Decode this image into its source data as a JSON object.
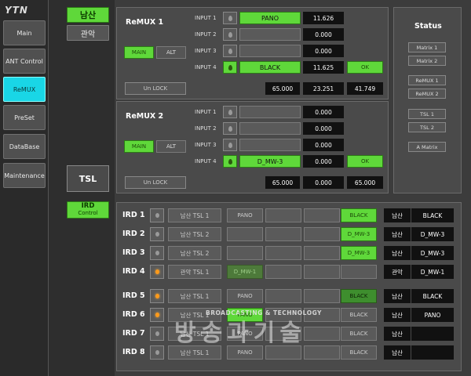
{
  "logo": "YTN",
  "sidebar": [
    {
      "label": "Main",
      "active": false
    },
    {
      "label": "ANT Control",
      "active": false
    },
    {
      "label": "ReMUX",
      "active": true
    },
    {
      "label": "PreSet",
      "active": false
    },
    {
      "label": "DataBase",
      "active": false
    },
    {
      "label": "Maintenance",
      "active": false
    }
  ],
  "site_tabs": {
    "namsan": "남산",
    "gwanak": "관악"
  },
  "tsl_button": "TSL",
  "ird_control": {
    "line1": "IRD",
    "line2": "Control"
  },
  "remux1": {
    "title": "ReMUX 1",
    "main": "MAIN",
    "alt": "ALT",
    "unlock": "Un LOCK",
    "inputs": [
      {
        "label": "INPUT 1",
        "lit": false,
        "source": "PANO",
        "source_lit": true,
        "value": "11.626",
        "ok": ""
      },
      {
        "label": "INPUT 2",
        "lit": false,
        "source": "",
        "source_lit": false,
        "value": "0.000",
        "ok": ""
      },
      {
        "label": "INPUT 3",
        "lit": false,
        "source": "",
        "source_lit": false,
        "value": "0.000",
        "ok": ""
      },
      {
        "label": "INPUT 4",
        "lit": true,
        "source": "BLACK",
        "source_lit": true,
        "value": "11.625",
        "ok": "OK"
      }
    ],
    "totals": [
      "65.000",
      "23.251",
      "41.749"
    ]
  },
  "remux2": {
    "title": "ReMUX 2",
    "main": "MAIN",
    "alt": "ALT",
    "unlock": "Un LOCK",
    "inputs": [
      {
        "label": "INPUT 1",
        "lit": false,
        "source": "",
        "source_lit": false,
        "value": "0.000",
        "ok": ""
      },
      {
        "label": "INPUT 2",
        "lit": false,
        "source": "",
        "source_lit": false,
        "value": "0.000",
        "ok": ""
      },
      {
        "label": "INPUT 3",
        "lit": false,
        "source": "",
        "source_lit": false,
        "value": "0.000",
        "ok": ""
      },
      {
        "label": "INPUT 4",
        "lit": true,
        "source": "D_MW-3",
        "source_lit": true,
        "value": "0.000",
        "ok": "OK"
      }
    ],
    "totals": [
      "65.000",
      "0.000",
      "65.000"
    ]
  },
  "status": {
    "title": "Status",
    "buttons": [
      "Matrix 1",
      "Matrix 2",
      "ReMUX 1",
      "ReMUX 2",
      "TSL 1",
      "TSL 2",
      "A Matrix"
    ]
  },
  "ird": [
    {
      "label": "IRD 1",
      "led": "off",
      "tsl": "남산 TSL 1",
      "c1": "PANO",
      "c1s": "",
      "c2": "",
      "c2s": "",
      "c3": "",
      "c3s": "",
      "c4": "BLACK",
      "c4s": "lit",
      "loc": "남산",
      "final": "BLACK"
    },
    {
      "label": "IRD 2",
      "led": "off",
      "tsl": "남산 TSL 2",
      "c1": "",
      "c1s": "",
      "c2": "",
      "c2s": "",
      "c3": "",
      "c3s": "",
      "c4": "D_MW-3",
      "c4s": "lit",
      "loc": "남산",
      "final": "D_MW-3"
    },
    {
      "label": "IRD 3",
      "led": "off",
      "tsl": "남산 TSL 2",
      "c1": "",
      "c1s": "",
      "c2": "",
      "c2s": "",
      "c3": "",
      "c3s": "",
      "c4": "D_MW-3",
      "c4s": "lit",
      "loc": "남산",
      "final": "D_MW-3"
    },
    {
      "label": "IRD 4",
      "led": "amber",
      "tsl": "관악 TSL 1",
      "c1": "D_MW-1",
      "c1s": "dim",
      "c2": "",
      "c2s": "",
      "c3": "",
      "c3s": "",
      "c4": "",
      "c4s": "",
      "loc": "관악",
      "final": "D_MW-1"
    },
    {
      "label": "IRD 5",
      "led": "amber",
      "tsl": "남산 TSL 1",
      "c1": "PANO",
      "c1s": "",
      "c2": "",
      "c2s": "",
      "c3": "",
      "c3s": "",
      "c4": "BLACK",
      "c4s": "darkgreen",
      "loc": "남산",
      "final": "BLACK"
    },
    {
      "label": "IRD 6",
      "led": "amber",
      "tsl": "남산 TSL 1",
      "c1": "PANO",
      "c1s": "lit",
      "c2": "",
      "c2s": "",
      "c3": "",
      "c3s": "",
      "c4": "BLACK",
      "c4s": "",
      "loc": "남산",
      "final": "PANO"
    },
    {
      "label": "IRD 7",
      "led": "off",
      "tsl": "남산 TSL 1",
      "c1": "PANO",
      "c1s": "",
      "c2": "",
      "c2s": "",
      "c3": "",
      "c3s": "",
      "c4": "BLACK",
      "c4s": "",
      "loc": "남산",
      "final": ""
    },
    {
      "label": "IRD 8",
      "led": "off",
      "tsl": "남산 TSL 1",
      "c1": "PANO",
      "c1s": "",
      "c2": "",
      "c2s": "",
      "c3": "",
      "c3s": "",
      "c4": "BLACK",
      "c4s": "",
      "loc": "남산",
      "final": ""
    }
  ],
  "watermark": {
    "small": "BROADCASTING & TECHNOLOGY",
    "big": "방송과기술"
  }
}
